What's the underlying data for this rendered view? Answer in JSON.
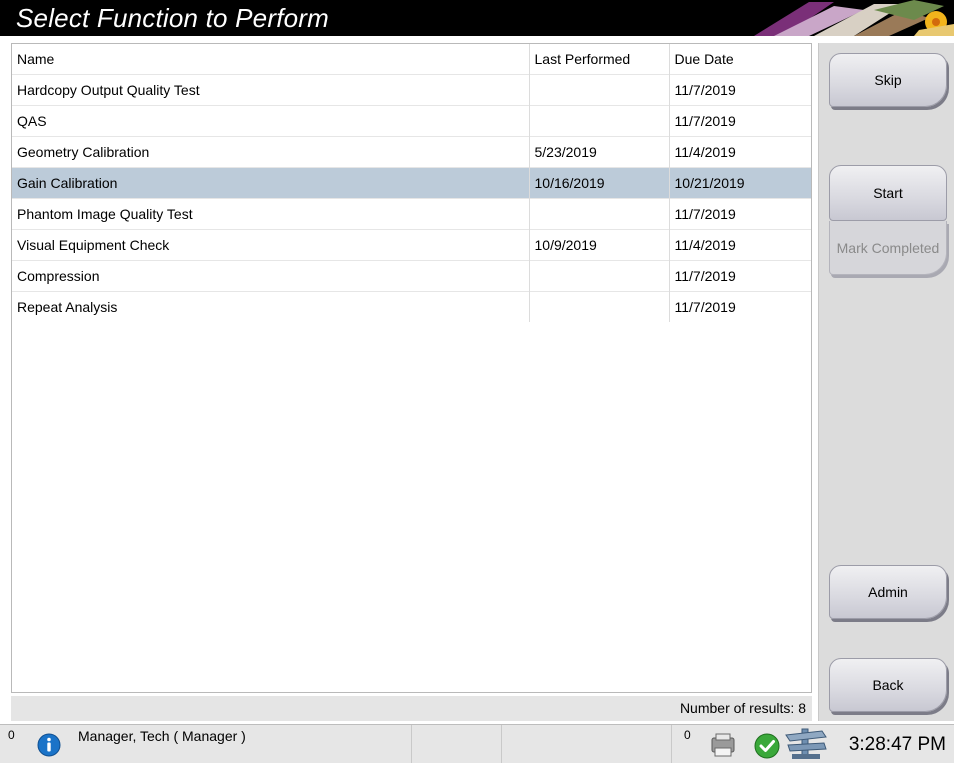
{
  "window": {
    "title": "Select Function to Perform"
  },
  "table": {
    "columns": [
      "Name",
      "Last Performed",
      "Due Date"
    ],
    "rows": [
      [
        "Hardcopy Output Quality Test",
        "",
        "11/7/2019"
      ],
      [
        "QAS",
        "",
        "11/7/2019"
      ],
      [
        "Geometry Calibration",
        "5/23/2019",
        "11/4/2019"
      ],
      [
        "Gain Calibration",
        "10/16/2019",
        "10/21/2019"
      ],
      [
        "Phantom Image Quality Test",
        "",
        "11/7/2019"
      ],
      [
        "Visual Equipment Check",
        "10/9/2019",
        "11/4/2019"
      ],
      [
        "Compression",
        "",
        "11/7/2019"
      ],
      [
        "Repeat Analysis",
        "",
        "11/7/2019"
      ]
    ],
    "selected_row": 3,
    "results_text": "Number of results: 8"
  },
  "buttons": {
    "skip": "Skip",
    "start": "Start",
    "mark_completed": "Mark Completed",
    "admin": "Admin",
    "back": "Back"
  },
  "status": {
    "alert_count": "0",
    "user": "Manager, Tech ( Manager )",
    "queue_count": "0",
    "clock": "3:28:47 PM",
    "icons": [
      "info-icon",
      "output-device-icon",
      "check-status-icon",
      "system-icon"
    ]
  },
  "colors": {
    "title_bg": "#000000",
    "selected_row": "#bccbd9",
    "info_blue": "#1a73c8",
    "check_green": "#3aa83a"
  }
}
